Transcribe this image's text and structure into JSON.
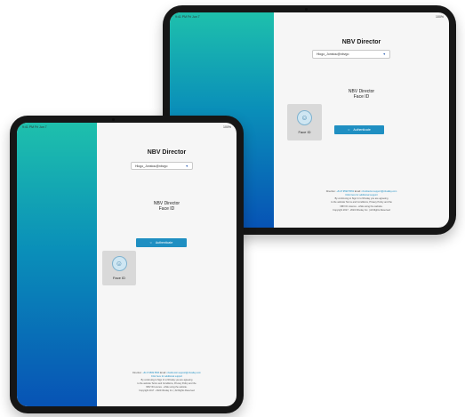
{
  "app": {
    "title": "NBV Director",
    "username": "Hlogo_Jonstou@nbvgo",
    "heading_line1": "NBV Director",
    "heading_line2": "Face ID",
    "face_id_label": "Face ID",
    "auth_button_label": "Authenticate"
  },
  "status_bar": {
    "back_time": "9:41 PM  Fri Jun 7",
    "back_right": "100%",
    "front_time": "9:41 PM  Fri Jun 7",
    "front_right": "100%"
  },
  "footer": {
    "direction_label": "Direction:",
    "phone": "+61 8 9599 5563",
    "email_label": "Email:",
    "email": "nbvdirector.support@nbvalley.com",
    "help_link": "Click here for additional support",
    "line1": "By continuing to Sign In to Nbvday you are agreeing",
    "line2": "to the website Terms and Conditions, Privacy Policy and the",
    "line3": "NBV ID Licence - while using the website.",
    "copyright": "Copyright 2017 - 2024 Nbvday Inc. | All Rights Reserved"
  },
  "icons": {
    "caret": "chevron-down-icon",
    "face": "face-id-icon",
    "auth": "face-scan-icon"
  },
  "colors": {
    "gradient_top": "#1ec0ac",
    "gradient_bottom": "#0753b5",
    "button": "#1f8fc2",
    "link": "#1f8fc2"
  }
}
